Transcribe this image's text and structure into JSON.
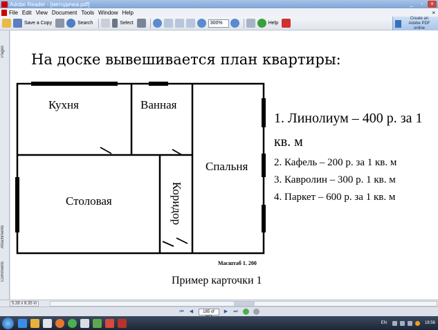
{
  "window": {
    "title": "Adobe Reader - [методичка.pdf]",
    "controls": [
      "_",
      "▫",
      "×"
    ]
  },
  "menu": {
    "items": [
      "File",
      "Edit",
      "View",
      "Document",
      "Tools",
      "Window",
      "Help"
    ],
    "close": "×"
  },
  "toolbar": {
    "save_copy": "Save a Copy",
    "search": "Search",
    "select": "Select",
    "zoom": "300%",
    "help": "Help",
    "create_pdf_line1": "Create an",
    "create_pdf_line2": "Adobe PDF online"
  },
  "left_panel": {
    "tabs": [
      "Pages",
      "Attachments",
      "Comments"
    ]
  },
  "document": {
    "heading": "На доске вывешивается план квартиры:",
    "rooms": {
      "kitchen": "Кухня",
      "bathroom": "Ванная",
      "bedroom": "Спальня",
      "dining": "Столовая",
      "corridor": "Коридор"
    },
    "prices": [
      "1. Линолиум – 400 р. за 1",
      "кв. м",
      "2. Кафель – 200 р. за 1 кв. м",
      "3. Кавролин – 300 р. 1 кв. м",
      "4. Паркет – 600 р. за 1 кв. м"
    ],
    "scale": "Масштаб 1. 200",
    "caption": "Пример карточки 1"
  },
  "status": {
    "page_size": "5.28 x 8.35 in"
  },
  "navigation": {
    "page_indicator": "185 of 287"
  },
  "taskbar": {
    "language": "EN",
    "time": "18:56"
  }
}
